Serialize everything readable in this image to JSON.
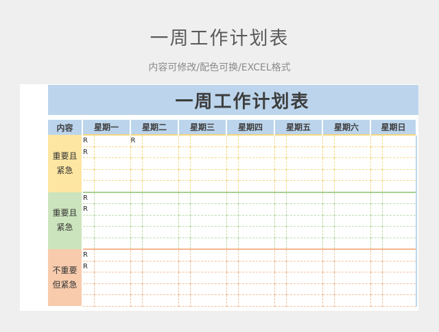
{
  "page": {
    "title": "一周工作计划表",
    "subtitle": "内容可修改/配色可换/EXCEL格式"
  },
  "sheet": {
    "banner_title": "一周工作计划表",
    "headers": [
      "内容",
      "星期一",
      "星期二",
      "星期三",
      "星期四",
      "星期五",
      "星期六",
      "星期日"
    ],
    "sections": [
      {
        "label_line1": "重要且",
        "label_line2": "紧急",
        "color": "#fde6a1",
        "rows": [
          [
            "R",
            "",
            "R",
            "",
            "",
            "",
            "",
            "",
            "",
            "",
            "",
            "",
            "",
            ""
          ],
          [
            "R",
            "",
            "",
            "",
            "",
            "",
            "",
            "",
            "",
            "",
            "",
            "",
            "",
            ""
          ],
          [
            "",
            "",
            "",
            "",
            "",
            "",
            "",
            "",
            "",
            "",
            "",
            "",
            "",
            ""
          ],
          [
            "",
            "",
            "",
            "",
            "",
            "",
            "",
            "",
            "",
            "",
            "",
            "",
            "",
            ""
          ],
          [
            "",
            "",
            "",
            "",
            "",
            "",
            "",
            "",
            "",
            "",
            "",
            "",
            "",
            ""
          ]
        ]
      },
      {
        "label_line1": "重要且",
        "label_line2": "紧急",
        "color": "#cce4bd",
        "rows": [
          [
            "R",
            "",
            "",
            "",
            "",
            "",
            "",
            "",
            "",
            "",
            "",
            "",
            "",
            ""
          ],
          [
            "R",
            "",
            "",
            "",
            "",
            "",
            "",
            "",
            "",
            "",
            "",
            "",
            "",
            ""
          ],
          [
            "",
            "",
            "",
            "",
            "",
            "",
            "",
            "",
            "",
            "",
            "",
            "",
            "",
            ""
          ],
          [
            "",
            "",
            "",
            "",
            "",
            "",
            "",
            "",
            "",
            "",
            "",
            "",
            "",
            ""
          ],
          [
            "",
            "",
            "",
            "",
            "",
            "",
            "",
            "",
            "",
            "",
            "",
            "",
            "",
            ""
          ]
        ]
      },
      {
        "label_line1": "不重要",
        "label_line2": "但紧急",
        "color": "#f7cbac",
        "rows": [
          [
            "R",
            "",
            "",
            "",
            "",
            "",
            "",
            "",
            "",
            "",
            "",
            "",
            "",
            ""
          ],
          [
            "R",
            "",
            "",
            "",
            "",
            "",
            "",
            "",
            "",
            "",
            "",
            "",
            "",
            ""
          ],
          [
            "",
            "",
            "",
            "",
            "",
            "",
            "",
            "",
            "",
            "",
            "",
            "",
            "",
            ""
          ],
          [
            "",
            "",
            "",
            "",
            "",
            "",
            "",
            "",
            "",
            "",
            "",
            "",
            "",
            ""
          ],
          [
            "",
            "",
            "",
            "",
            "",
            "",
            "",
            "",
            "",
            "",
            "",
            "",
            "",
            ""
          ]
        ]
      }
    ]
  }
}
